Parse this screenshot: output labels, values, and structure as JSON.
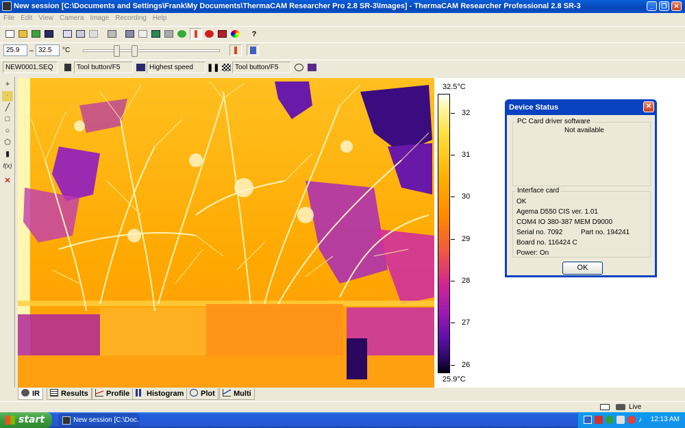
{
  "window": {
    "title": "New session [C:\\Documents and Settings\\Frank\\My Documents\\ThermaCAM Researcher Pro 2.8 SR-3\\Images] - ThermaCAM Researcher Professional 2.8 SR-3",
    "min": "_",
    "max": "❐",
    "close": "✕"
  },
  "menu": [
    "File",
    "Edit",
    "View",
    "Camera",
    "Image",
    "Recording",
    "Help"
  ],
  "range": {
    "low": "25.9",
    "dash": "–",
    "high": "32.5",
    "unit": "°C"
  },
  "recording": {
    "file": "NEW0001.SEQ",
    "trigger": "Tool button/F5",
    "speed": "Highest speed",
    "stop": "Tool button/F5"
  },
  "scale": {
    "top": "32.5°C",
    "bottom": "25.9°C",
    "ticks": [
      "32",
      "31",
      "30",
      "29",
      "28",
      "27",
      "26"
    ]
  },
  "tabs": [
    "IR",
    "Results",
    "Profile",
    "Histogram",
    "Plot",
    "Multi"
  ],
  "status": {
    "live": "Live"
  },
  "dialog": {
    "title": "Device Status",
    "group1": "PC Card driver software",
    "driver": "Not available",
    "group2": "Interface card",
    "ok_status": "OK",
    "model": "Agema D550 CIS ver. 1.01",
    "ports": "COM4 IO 380-387 MEM D9000",
    "serial": "Serial no. 7092",
    "part": "Part no. 194241",
    "board": "Board no. 116424 C",
    "power": "Power: On",
    "ok": "OK"
  },
  "taskbar": {
    "start": "start",
    "item": "New session [C:\\Doc...",
    "clock": "12:13 AM"
  }
}
